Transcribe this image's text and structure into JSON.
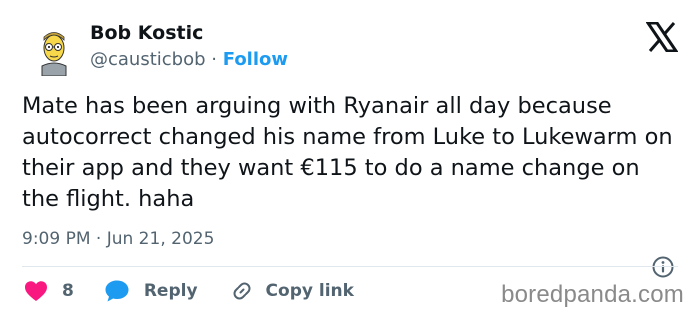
{
  "author": {
    "name": "Bob Kostic",
    "handle": "@causticbob",
    "separator": "·",
    "follow_label": "Follow"
  },
  "tweet": {
    "text": "Mate has been arguing with Ryanair all day because autocorrect changed his name from Luke to Lukewarm on their app and they want €115 to do a name change on the flight. haha",
    "time": "9:09 PM",
    "date_separator": "·",
    "date": "Jun 21, 2025"
  },
  "actions": {
    "like_count": "8",
    "reply_label": "Reply",
    "copy_label": "Copy link"
  },
  "watermark": "boredpanda.com",
  "colors": {
    "accent": "#1d9bf0",
    "like": "#f91880",
    "text": "#0f1419",
    "muted": "#536471"
  },
  "icons": [
    "avatar",
    "x-logo-icon",
    "info-icon",
    "heart-icon",
    "reply-bubble-icon",
    "link-icon"
  ]
}
